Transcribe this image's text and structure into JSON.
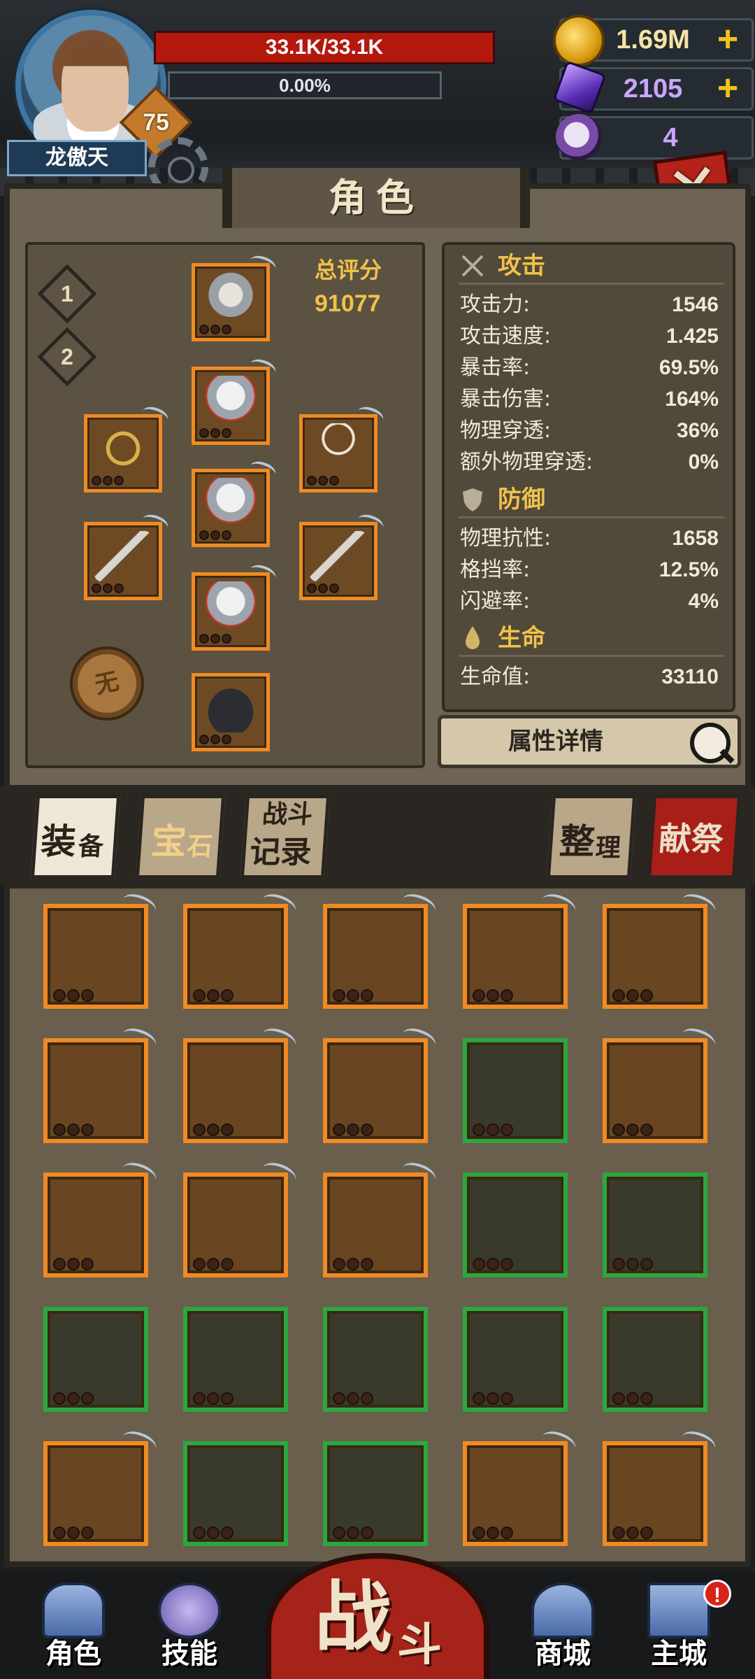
{
  "player": {
    "name": "龙傲天",
    "level": "75",
    "hp_text": "33.1K/33.1K",
    "exp_text": "0.00%"
  },
  "resources": {
    "gold": "1.69M",
    "gems": "2105",
    "skulls": "4"
  },
  "panel": {
    "title": "角色",
    "loadout_1": "1",
    "loadout_2": "2",
    "score_label": "总评分",
    "score_value": "91077",
    "detail_button": "属性详情"
  },
  "stats": {
    "attack_title": "攻击",
    "defense_title": "防御",
    "life_title": "生命",
    "attack": [
      {
        "label": "攻击力:",
        "value": "1546"
      },
      {
        "label": "攻击速度:",
        "value": "1.425"
      },
      {
        "label": "暴击率:",
        "value": "69.5%"
      },
      {
        "label": "暴击伤害:",
        "value": "164%"
      },
      {
        "label": "物理穿透:",
        "value": "36%"
      },
      {
        "label": "额外物理穿透:",
        "value": "0%"
      }
    ],
    "defense": [
      {
        "label": "物理抗性:",
        "value": "1658"
      },
      {
        "label": "格挡率:",
        "value": "12.5%"
      },
      {
        "label": "闪避率:",
        "value": "4%"
      }
    ],
    "life": [
      {
        "label": "生命值:",
        "value": "33110"
      }
    ]
  },
  "tabs": {
    "equip_1": "装",
    "equip_2": "备",
    "gem_1": "宝",
    "gem_2": "石",
    "record_1": "战斗",
    "record_2": "记录",
    "sort_1": "整",
    "sort_2": "理",
    "sacrifice": "献祭"
  },
  "nav": {
    "role": "角色",
    "skill": "技能",
    "battle_1": "战",
    "battle_2": "斗",
    "shop": "商城",
    "city": "主城",
    "city_alert": "!"
  },
  "colors": {
    "rare_border": "#f08a23",
    "uncommon_border": "#2aa83f",
    "hp_red": "#b3180d",
    "gold_text": "#f0c24b"
  },
  "icons": [
    "gold-coin-icon",
    "purple-gem-icon",
    "ram-skull-icon",
    "close-icon",
    "gear-icon",
    "sword-icon",
    "shield-icon",
    "drop-icon",
    "magnifier-icon"
  ]
}
